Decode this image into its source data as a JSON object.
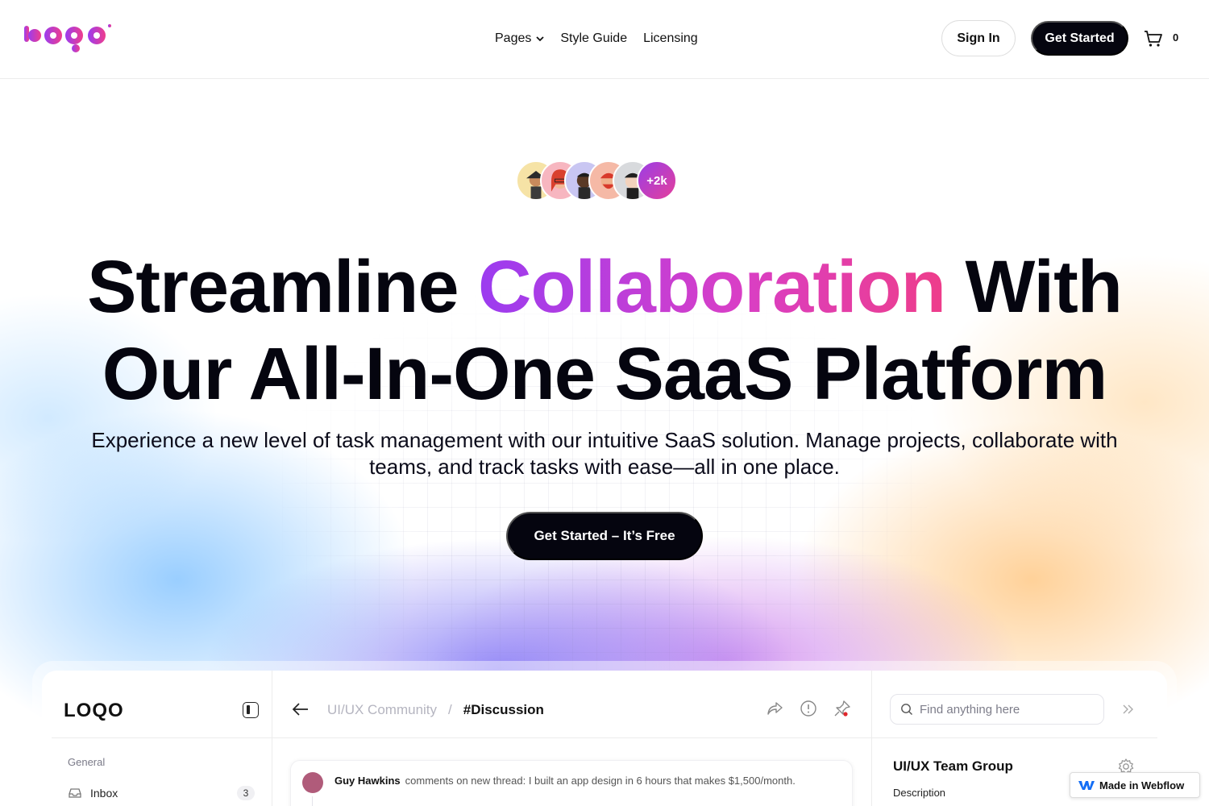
{
  "header": {
    "logo_alt": "logo",
    "nav": [
      {
        "label": "Pages",
        "has_dropdown": true
      },
      {
        "label": "Style Guide",
        "has_dropdown": false
      },
      {
        "label": "Licensing",
        "has_dropdown": false
      }
    ],
    "sign_in_label": "Sign In",
    "get_started_label": "Get Started",
    "cart_icon": "cart-icon",
    "cart_count": "0"
  },
  "hero": {
    "avatars_more": "+2k",
    "headline_part1": "Streamline ",
    "headline_highlight": "Collaboration",
    "headline_part2": " With",
    "headline_line2": "Our All-In-One SaaS Platform",
    "subtitle": "Experience a new level of task management with our intuitive SaaS solution. Manage projects, collaborate with teams, and track tasks with ease—all in one place.",
    "cta_label": "Get Started – It’s Free",
    "highlight_colors": [
      "#9b3cf0",
      "#d83fc7",
      "#ee3d8a"
    ]
  },
  "app_preview": {
    "brand": "LOQO",
    "sidebar": {
      "section_label": "General",
      "items": [
        {
          "label": "Inbox",
          "count": "3",
          "icon": "inbox-icon"
        }
      ]
    },
    "breadcrumb": {
      "parent": "UI/UX Community",
      "separator": "/",
      "current": "#Discussion"
    },
    "thread": {
      "author": "Guy Hawkins",
      "text": "comments on new thread: I built an app design in 6 hours that makes $1,500/month."
    },
    "search": {
      "placeholder": "Find anything here",
      "value": ""
    },
    "panel": {
      "title": "UI/UX Team Group",
      "description_label": "Description"
    }
  },
  "badge": {
    "label": "Made in Webflow"
  }
}
